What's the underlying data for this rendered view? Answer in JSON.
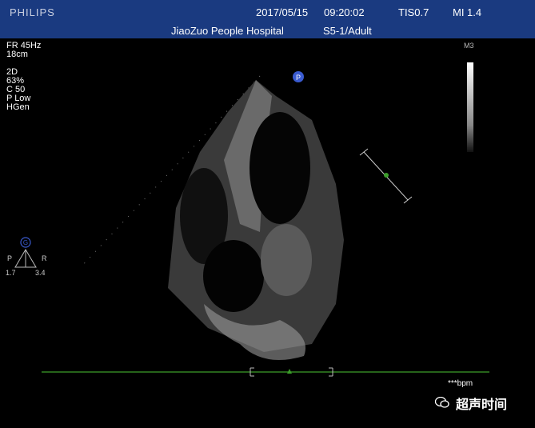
{
  "header": {
    "brand": "PHILIPS",
    "date": "2017/05/15",
    "time": "09:20:02",
    "tis": "TIS0.7",
    "mi": "MI 1.4",
    "hospital": "JiaoZuo  People Hospital",
    "probe": "S5-1/Adult"
  },
  "params": [
    "FR 45Hz",
    "18cm",
    "",
    "2D",
    " 63%",
    " C 50",
    " P Low",
    " HGen"
  ],
  "grayscale_label": "M3",
  "orientation": {
    "marker": "G",
    "left": "P",
    "right": "R",
    "left_val": "1.7",
    "right_val": "3.4"
  },
  "probe_marker": "P",
  "bpm": "***bpm",
  "watermark": "超声时间",
  "colors": {
    "header_bg": "#1a3a80",
    "ecg_line": "#3c9e2a",
    "accent": "#3a5bd0"
  }
}
